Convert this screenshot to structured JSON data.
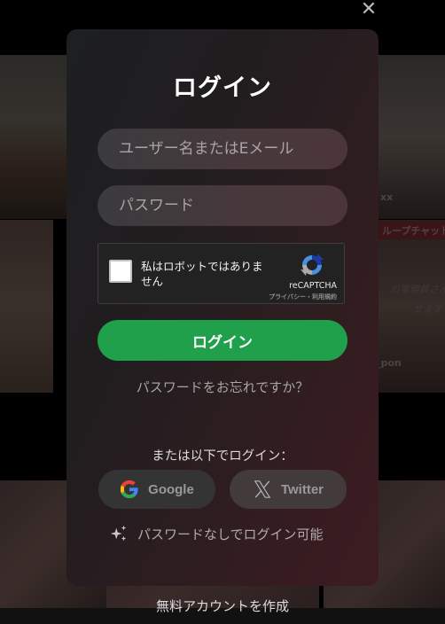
{
  "background": {
    "labels": [
      "xx",
      "ループチャット",
      "の事務員さん",
      "せます",
      "_pon"
    ]
  },
  "close": {
    "icon": "close-icon",
    "glyph": "✕"
  },
  "modal": {
    "title": "ログイン",
    "username": {
      "placeholder": "ユーザー名またはEメール",
      "value": ""
    },
    "password": {
      "placeholder": "パスワード",
      "value": ""
    },
    "captcha": {
      "label": "私はロボットではありません",
      "brand": "reCAPTCHA",
      "links": "プライバシー・利用規約",
      "checked": false
    },
    "login_button": "ログイン",
    "forgot_password": "パスワードをお忘れですか？",
    "alt_login_label": "または以下でログイン：",
    "social": [
      {
        "name": "Google",
        "icon": "google-icon"
      },
      {
        "name": "Twitter",
        "icon": "x-icon"
      }
    ],
    "passwordless": "パスワードなしでログイン可能",
    "colors": {
      "primary": "#21a04c"
    }
  },
  "footer": {
    "create_account": "無料アカウントを作成"
  }
}
